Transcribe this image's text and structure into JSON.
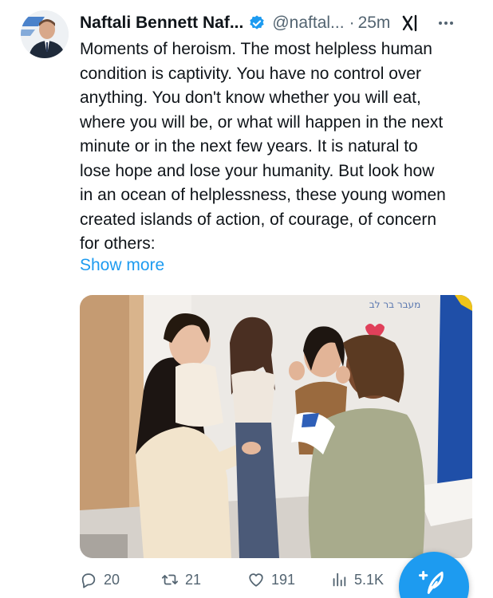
{
  "tweet": {
    "author_name": "Naftali Bennett Naf...",
    "author_handle": "@naftal...",
    "separator": "·",
    "time": "25m",
    "body_lines": [
      "Moments of heroism. The most helpless human",
      "condition is captivity. You have no control over",
      "anything. You don't know whether you will eat,",
      "where you will be, or what will happen in the next",
      "minute or in the next few years. It is natural to",
      "lose hope and lose your humanity. But look how",
      "in an ocean of helplessness, these young women",
      "created islands of action, of courage, of concern",
      "for others:"
    ],
    "show_more": "Show more",
    "photo_sign_text": "מעבר בר לב",
    "stats": {
      "replies": "20",
      "retweets": "21",
      "likes": "191",
      "views": "5.1K"
    }
  },
  "icons": {
    "verified": "verified-badge-icon",
    "grok": "grok-icon",
    "more": "more-dots-icon",
    "reply": "reply-icon",
    "retweet": "retweet-icon",
    "like": "heart-icon",
    "views": "views-chart-icon",
    "compose": "compose-feather-icon"
  },
  "colors": {
    "accent": "#1d9bf0",
    "text": "#0f1419",
    "muted": "#536471"
  }
}
